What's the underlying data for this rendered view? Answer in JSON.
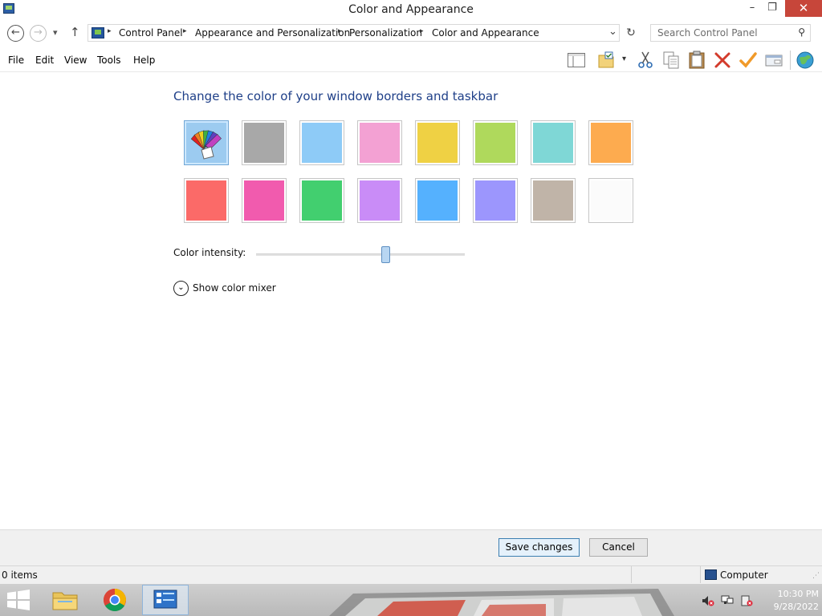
{
  "window": {
    "title": "Color and Appearance",
    "minimize_glyph": "–",
    "restore_glyph": "❐",
    "close_glyph": "✕"
  },
  "nav": {
    "back_glyph": "←",
    "forward_glyph": "→",
    "up_glyph": "↑",
    "dropdown_glyph": "▾",
    "breadcrumbs": [
      "Control Panel",
      "Appearance and Personalization",
      "Personalization",
      "Color and Appearance"
    ],
    "breadcrumb_separator": "▸",
    "address_dropdown_glyph": "⌄",
    "refresh_glyph": "↻",
    "search_placeholder": "Search Control Panel",
    "search_icon": "⚲"
  },
  "menu": {
    "items": [
      "File",
      "Edit",
      "View",
      "Tools",
      "Help"
    ]
  },
  "toolbar": {
    "icons": [
      "preview-pane-icon",
      "select-icon",
      "cut-icon",
      "copy-icon",
      "paste-icon",
      "delete-icon",
      "check-icon",
      "properties-icon",
      "globe-icon"
    ]
  },
  "content": {
    "heading": "Change the color of your window borders and taskbar",
    "swatches": [
      {
        "name": "automatic",
        "color": "#9ccbf0",
        "selected": true
      },
      {
        "name": "gray",
        "color": "#a8a8a8"
      },
      {
        "name": "light-blue",
        "color": "#8ecbf7"
      },
      {
        "name": "pink",
        "color": "#f3a1d3"
      },
      {
        "name": "yellow",
        "color": "#efd144"
      },
      {
        "name": "lime",
        "color": "#afd95c"
      },
      {
        "name": "teal",
        "color": "#7fd7d6"
      },
      {
        "name": "orange",
        "color": "#fdab4f"
      },
      {
        "name": "red",
        "color": "#fb6a68"
      },
      {
        "name": "magenta",
        "color": "#f15bae"
      },
      {
        "name": "green",
        "color": "#42cf6f"
      },
      {
        "name": "violet",
        "color": "#c98cf7"
      },
      {
        "name": "blue",
        "color": "#55b1fe"
      },
      {
        "name": "periwinkle",
        "color": "#9c96fd"
      },
      {
        "name": "taupe",
        "color": "#c0b4a8"
      },
      {
        "name": "white",
        "color": "#fbfbfb"
      }
    ],
    "intensity_label": "Color intensity:",
    "intensity_value": 0.62,
    "mixer_toggle_glyph": "⌄",
    "mixer_label": "Show color mixer"
  },
  "buttons": {
    "save": "Save changes",
    "cancel": "Cancel"
  },
  "status": {
    "items": "0 items",
    "location": "Computer"
  },
  "taskbar": {
    "time": "10:30 PM",
    "date": "9/28/2022",
    "apps": [
      "file-explorer-icon",
      "chrome-icon",
      "control-panel-icon"
    ]
  },
  "colors": {
    "heading": "#1e3f88",
    "close_button": "#c7463a",
    "accent_border": "#3c7fb1"
  }
}
